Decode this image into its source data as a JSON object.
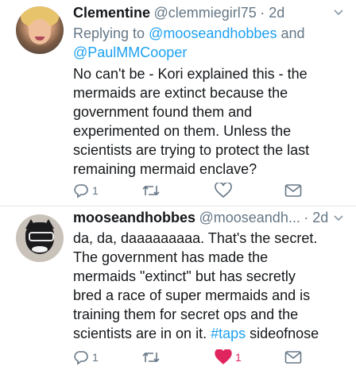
{
  "tweets": [
    {
      "name": "Clementine",
      "handle": "@clemmiegirl75",
      "time": "· 2d",
      "replying_prefix": "Replying to ",
      "replying_to_1": "@mooseandhobbes",
      "replying_and": " and",
      "replying_to_2": "@PaulMMCooper",
      "text": "No can't be - Kori explained this - the\nmermaids are extinct because the\ngovernment found them and\nexperimented on them. Unless the\nscientists are trying to protect the last\nremaining mermaid enclave?",
      "reply_count": "1",
      "retweet_count": "",
      "like_count": ""
    },
    {
      "name": "mooseandhobbes",
      "handle": "@mooseandh...",
      "time": "· 2d",
      "text": "da, da, daaaaaaaaa. That's the secret.\nThe government has made the\nmermaids \"extinct\" but has secretly\nbred a race of super mermaids and is\ntraining them for secret ops and the\nscientists are in on it. ",
      "hashtag": "#taps",
      "text_tail": " sideofnose",
      "reply_count": "1",
      "retweet_count": "",
      "like_count": "1"
    }
  ],
  "icons": {
    "reply": "reply-icon",
    "retweet": "retweet-icon",
    "like": "heart-icon",
    "dm": "direct-message-icon",
    "more": "chevron-down-icon"
  },
  "colors": {
    "link": "#1da1f2",
    "muted": "#657786",
    "like": "#e0245e"
  }
}
